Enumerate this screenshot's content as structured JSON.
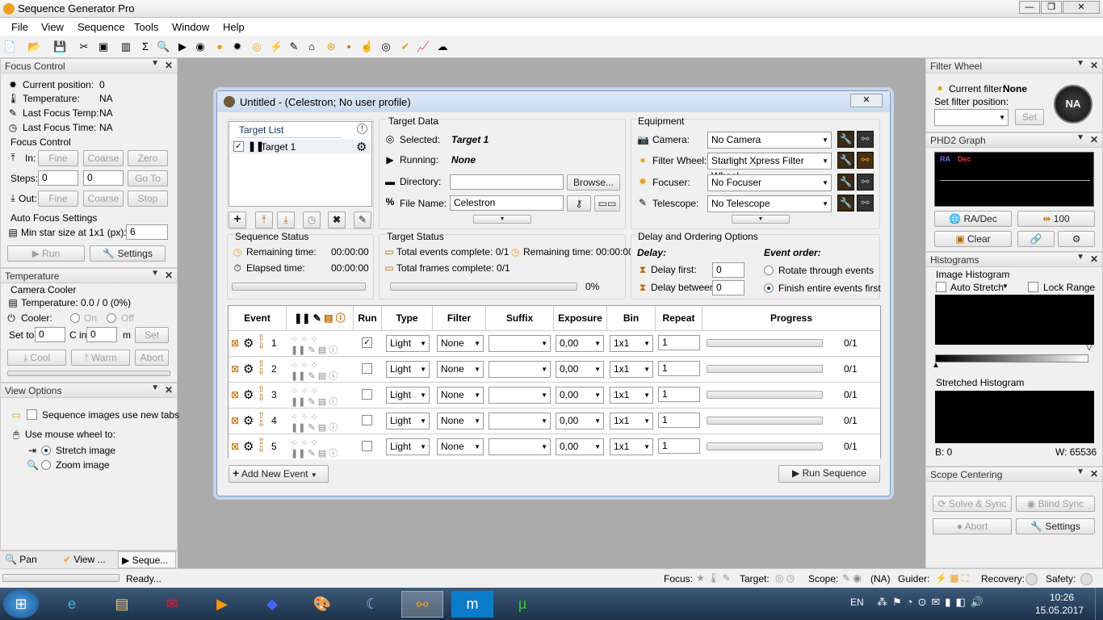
{
  "app": {
    "title": "Sequence Generator Pro"
  },
  "menu": [
    "File",
    "View",
    "Sequence",
    "Tools",
    "Window",
    "Help"
  ],
  "focus_control": {
    "title": "Focus Control",
    "current_position_label": "Current position:",
    "current_position": "0",
    "temperature_label": "Temperature:",
    "temperature": "NA",
    "last_temp_label": "Last Focus Temp:",
    "last_temp": "NA",
    "last_time_label": "Last Focus Time:",
    "last_time": "NA",
    "section": "Focus Control",
    "in_label": "In:",
    "fine": "Fine",
    "coarse": "Coarse",
    "zero": "Zero",
    "steps_label": "Steps:",
    "steps1": "0",
    "steps2": "0",
    "goto": "Go To",
    "out_label": "Out:",
    "stop": "Stop",
    "af_section": "Auto Focus Settings",
    "min_star_label": "Min star size at 1x1 (px):",
    "min_star": "6",
    "run": "Run",
    "settings": "Settings"
  },
  "temperature_panel": {
    "title": "Temperature",
    "section": "Camera Cooler",
    "temp_label": "Temperature: 0.0 / 0 (0%)",
    "cooler_label": "Cooler:",
    "on": "On",
    "off": "Off",
    "set_to_label": "Set to",
    "set_to": "0",
    "c_in": "C in",
    "c_in_val": "0",
    "m": "m",
    "set": "Set",
    "cool": "Cool",
    "warm": "Warm",
    "abort": "Abort"
  },
  "view_options": {
    "title": "View Options",
    "new_tabs": "Sequence images use new tabs",
    "wheel_label": "Use mouse wheel to:",
    "stretch": "Stretch image",
    "zoom": "Zoom image"
  },
  "bottom_tabs": [
    "Pan an...",
    "View ...",
    "Seque..."
  ],
  "seq_window": {
    "title": "Untitled - (Celestron; No user profile)"
  },
  "target_list": {
    "title": "Target List",
    "items": [
      "Target 1"
    ]
  },
  "target_data": {
    "title": "Target Data",
    "selected_label": "Selected:",
    "selected": "Target 1",
    "running_label": "Running:",
    "running": "None",
    "directory_label": "Directory:",
    "browse": "Browse...",
    "filename_label": "File Name:",
    "filename": "Celestron"
  },
  "equipment": {
    "title": "Equipment",
    "camera_label": "Camera:",
    "camera": "No Camera",
    "fw_label": "Filter Wheel:",
    "fw": "Starlight Xpress Filter Wheel",
    "focuser_label": "Focuser:",
    "focuser": "No Focuser",
    "telescope_label": "Telescope:",
    "telescope": "No Telescope"
  },
  "sequence_status": {
    "title": "Sequence Status",
    "remaining_label": "Remaining time:",
    "remaining": "00:00:00",
    "elapsed_label": "Elapsed time:",
    "elapsed": "00:00:00"
  },
  "target_status": {
    "title": "Target Status",
    "events_label": "Total events complete: 0/1",
    "remaining_label": "Remaining time: 00:00:00",
    "frames_label": "Total frames complete: 0/1",
    "percent": "0%",
    "progress": 0
  },
  "delay": {
    "title": "Delay and Ordering Options",
    "delay_label": "Delay:",
    "delay_first_label": "Delay first:",
    "delay_first": "0",
    "delay_between_label": "Delay between:",
    "delay_between": "0",
    "order_label": "Event order:",
    "rotate": "Rotate through events",
    "finish": "Finish entire events first"
  },
  "events": {
    "headers": [
      "Event",
      "Run",
      "Type",
      "Filter",
      "Suffix",
      "Exposure",
      "Bin",
      "Repeat",
      "Progress"
    ],
    "rows": [
      {
        "n": "1",
        "type": "Light",
        "filter": "None",
        "suffix": "",
        "exposure": "0,00",
        "bin": "1x1",
        "repeat": "1",
        "progress": "0/1",
        "run": true
      },
      {
        "n": "2",
        "type": "Light",
        "filter": "None",
        "suffix": "",
        "exposure": "0,00",
        "bin": "1x1",
        "repeat": "1",
        "progress": "0/1",
        "run": false
      },
      {
        "n": "3",
        "type": "Light",
        "filter": "None",
        "suffix": "",
        "exposure": "0,00",
        "bin": "1x1",
        "repeat": "1",
        "progress": "0/1",
        "run": false
      },
      {
        "n": "4",
        "type": "Light",
        "filter": "None",
        "suffix": "",
        "exposure": "0,00",
        "bin": "1x1",
        "repeat": "1",
        "progress": "0/1",
        "run": false
      },
      {
        "n": "5",
        "type": "Light",
        "filter": "None",
        "suffix": "",
        "exposure": "0,00",
        "bin": "1x1",
        "repeat": "1",
        "progress": "0/1",
        "run": false
      }
    ],
    "add": "Add New Event",
    "run": "Run Sequence"
  },
  "filter_wheel": {
    "title": "Filter Wheel",
    "current_label": "Current filter:",
    "current": "None",
    "set_label": "Set filter position:",
    "set": "Set",
    "badge": "NA"
  },
  "phd2": {
    "title": "PHD2 Graph",
    "ra": "RA",
    "dec": "Dec",
    "radec": "RA/Dec",
    "scale": "100",
    "clear": "Clear"
  },
  "histograms": {
    "title": "Histograms",
    "image_histogram": "Image Histogram",
    "auto_stretch": "Auto Stretch",
    "lock_range": "Lock Range",
    "stretched": "Stretched Histogram",
    "b": "B: 0",
    "w": "W: 65536"
  },
  "scope_centering": {
    "title": "Scope Centering",
    "solve": "Solve & Sync",
    "blind": "Blind Sync",
    "abort": "Abort",
    "settings": "Settings"
  },
  "statusbar": {
    "ready": "Ready...",
    "focus": "Focus:",
    "target": "Target:",
    "scope": "Scope:",
    "scope_val": "(NA)",
    "guider": "Guider:",
    "recovery": "Recovery:",
    "safety": "Safety:"
  },
  "taskbar": {
    "lang": "EN",
    "time": "10:26",
    "date": "15.05.2017"
  },
  "colors": {
    "accent": "#e8a020",
    "task": "#1d3149"
  }
}
